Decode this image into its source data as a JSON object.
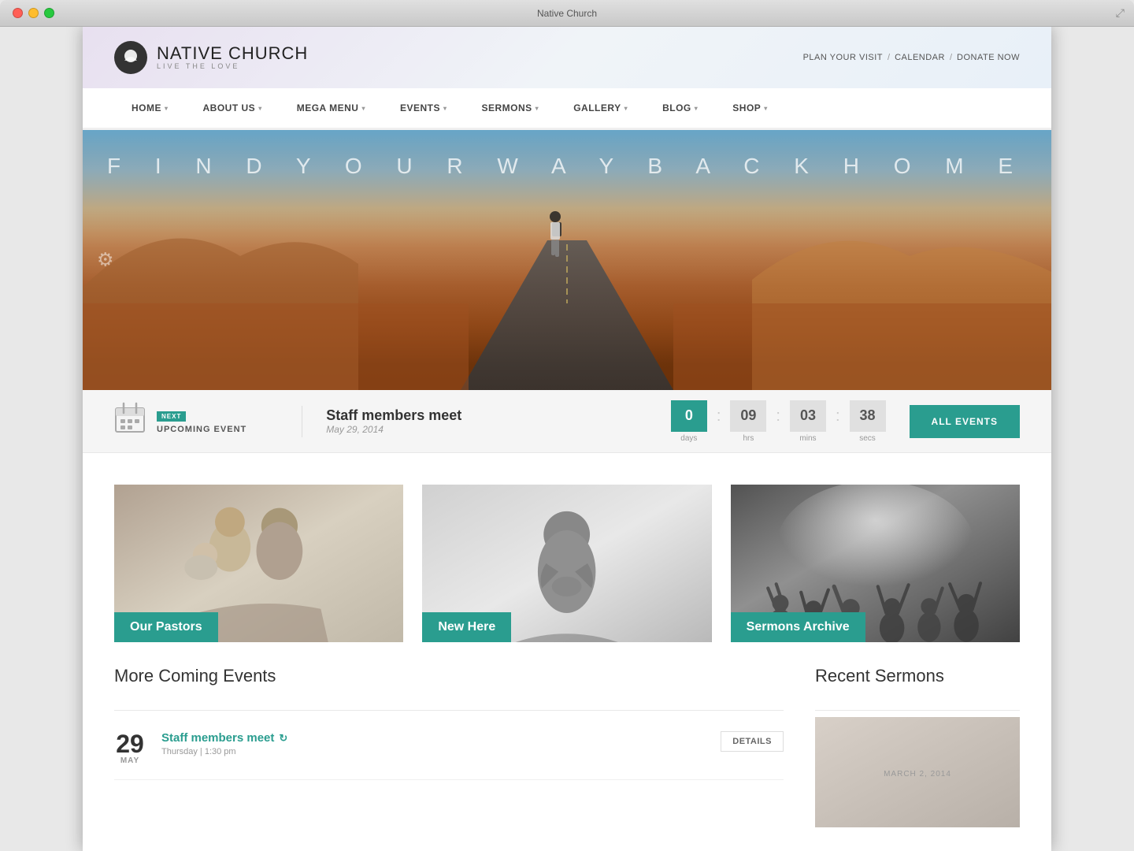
{
  "window": {
    "title": "Native Church"
  },
  "header": {
    "logo_name": "NATIVE",
    "logo_name2": "CHURCH",
    "logo_tagline": "LIVE THE LOVE",
    "top_links": [
      {
        "label": "PLAN YOUR VISIT"
      },
      {
        "label": "/"
      },
      {
        "label": "CALENDAR"
      },
      {
        "label": "/"
      },
      {
        "label": "DONATE NOW"
      }
    ]
  },
  "nav": {
    "items": [
      {
        "label": "HOME",
        "has_dropdown": true
      },
      {
        "label": "ABOUT US",
        "has_dropdown": true
      },
      {
        "label": "MEGA MENU",
        "has_dropdown": true
      },
      {
        "label": "EVENTS",
        "has_dropdown": true
      },
      {
        "label": "SERMONS",
        "has_dropdown": true
      },
      {
        "label": "GALLERY",
        "has_dropdown": true
      },
      {
        "label": "BLOG",
        "has_dropdown": true
      },
      {
        "label": "SHOP",
        "has_dropdown": true
      }
    ]
  },
  "hero": {
    "tagline": "F I N D   Y O U R   W A Y   B A C K   H O M E"
  },
  "upcoming_event": {
    "badge": "NEXT",
    "label": "UPCOMING EVENT",
    "event_name": "Staff members meet",
    "event_date": "May 29, 2014",
    "countdown": {
      "days": "0",
      "hrs": "09",
      "mins": "03",
      "secs": "38"
    },
    "all_events_btn": "ALL EVENTS"
  },
  "cards": [
    {
      "label": "Our Pastors",
      "id": "pastors"
    },
    {
      "label": "New Here",
      "id": "new-here"
    },
    {
      "label": "Sermons Archive",
      "id": "sermons-archive"
    }
  ],
  "more_coming_events": {
    "title": "More Coming Events",
    "events": [
      {
        "day": "29",
        "month": "MAY",
        "title": "Staff members meet",
        "time": "Thursday | 1:30 pm",
        "details_btn": "DETAILS"
      }
    ]
  },
  "recent_sermons": {
    "title": "Recent Sermons",
    "date_preview": "MARCH 2, 2014"
  }
}
